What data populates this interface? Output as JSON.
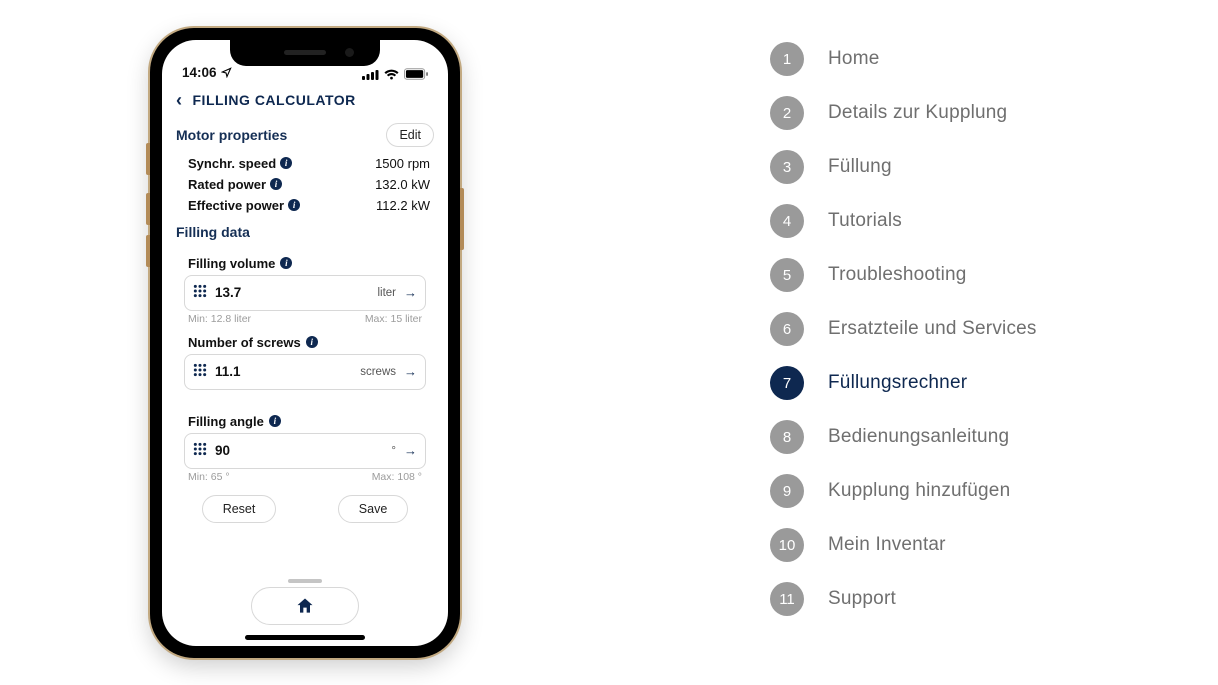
{
  "status": {
    "time": "14:06"
  },
  "app": {
    "title": "FILLING CALCULATOR",
    "motor": {
      "heading": "Motor properties",
      "edit": "Edit",
      "rows": [
        {
          "label": "Synchr. speed",
          "value": "1500 rpm"
        },
        {
          "label": "Rated power",
          "value": "132.0 kW"
        },
        {
          "label": "Effective power",
          "value": "112.2 kW"
        }
      ]
    },
    "filling": {
      "heading": "Filling data",
      "fields": [
        {
          "label": "Filling volume",
          "value": "13.7",
          "unit": "liter",
          "min": "Min: 12.8 liter",
          "max": "Max: 15 liter"
        },
        {
          "label": "Number of screws",
          "value": "11.1",
          "unit": "screws",
          "min": "",
          "max": ""
        },
        {
          "label": "Filling angle",
          "value": "90",
          "unit": "°",
          "min": "Min: 65 °",
          "max": "Max: 108 °"
        }
      ]
    },
    "buttons": {
      "reset": "Reset",
      "save": "Save"
    }
  },
  "menu": {
    "active_index": 6,
    "items": [
      "Home",
      "Details zur Kupplung",
      "Füllung",
      "Tutorials",
      "Troubleshooting",
      "Ersatzteile und Services",
      "Füllungsrechner",
      "Bedienungsanleitung",
      "Kupplung hinzufügen",
      "Mein Inventar",
      "Support"
    ]
  }
}
